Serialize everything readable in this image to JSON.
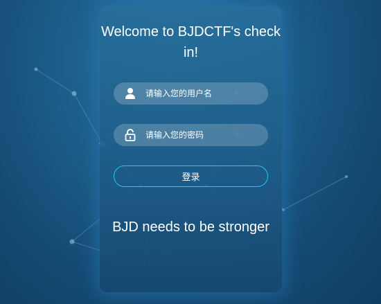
{
  "login": {
    "title": "Welcome to BJDCTF's check in!",
    "username_placeholder": "请输入您的用户名",
    "password_placeholder": "请输入您的密码",
    "login_label": "登录",
    "tagline": "BJD needs to be stronger"
  },
  "icons": {
    "username": "user-icon",
    "password": "lock-icon"
  },
  "colors": {
    "background": "#1d5f8c",
    "button_border": "#25c8f0",
    "text": "#ffffff"
  }
}
